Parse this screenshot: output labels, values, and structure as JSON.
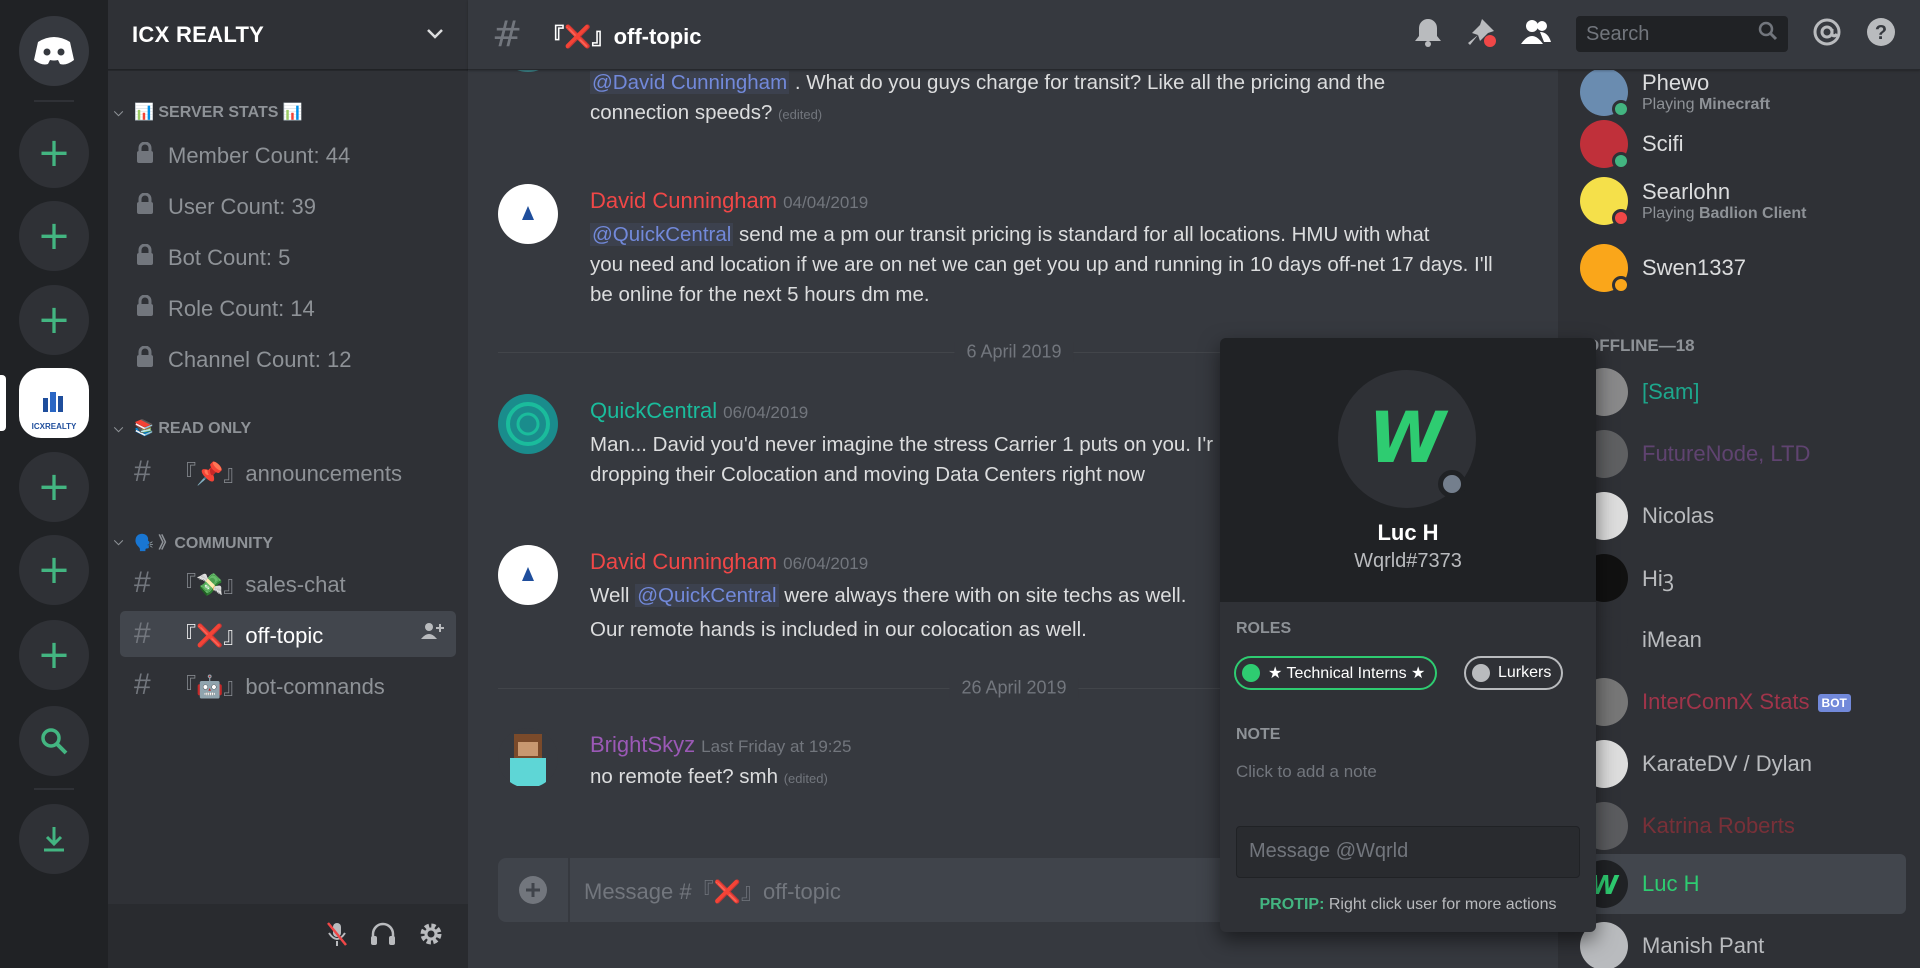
{
  "server": {
    "name": "ICX REALTY",
    "active_logo_text": "ICXREALTY"
  },
  "categories": {
    "stats": "📊 SERVER STATS 📊",
    "read_only": "📚 READ ONLY",
    "community": "🗣️ 》COMMUNITY"
  },
  "stats_channels": [
    "Member Count: 44",
    "User Count: 39",
    "Bot Count: 5",
    "Role Count: 14",
    "Channel Count: 12"
  ],
  "text_channels": {
    "announcements": "『📌』announcements",
    "sales_chat": "『💸』sales-chat",
    "off_topic": "『❌』off-topic",
    "bot_commands": "『🤖』bot-comnands"
  },
  "header": {
    "channel": "『❌』off-topic",
    "search_placeholder": "Search"
  },
  "messages": [
    {
      "mention": "@David Cunningham",
      "text": ". What do you guys charge for transit? Like all the pricing and the",
      "text2": "connection speeds?",
      "edited": "(edited)"
    },
    {
      "author": "David Cunningham",
      "time": "04/04/2019",
      "mention": "@QuickCentral",
      "text": "send me a pm our transit pricing is standard for all locations. HMU with what",
      "text2": "you need and location if we are on net we can get you up and running in 10 days off-net 17 days. I'll",
      "text3": "be online for the next 5 hours dm me."
    },
    {
      "author": "QuickCentral",
      "time": "06/04/2019",
      "text": "Man... David you'd never imagine the stress Carrier 1 puts on you. I'r",
      "text2": "dropping their Colocation and moving Data Centers right now"
    },
    {
      "author": "David Cunningham",
      "time": "06/04/2019",
      "pre": "Well",
      "mention": "@QuickCentral",
      "text": "were always there with on site techs as well.",
      "text2": "Our remote hands is included in our colocation as well."
    },
    {
      "author": "BrightSkyz",
      "time": "Last Friday at 19:25",
      "text": "no remote feet? smh",
      "edited": "(edited)"
    }
  ],
  "dividers": [
    "6 April 2019",
    "26 April 2019"
  ],
  "composer": {
    "placeholder": "Message #『❌』off-topic"
  },
  "members": {
    "online": [
      {
        "name": "Phewo",
        "activity_prefix": "Playing",
        "activity": "Minecraft"
      },
      {
        "name": "Scifi"
      },
      {
        "name": "Searlohn",
        "activity_prefix": "Playing",
        "activity": "Badlion Client"
      },
      {
        "name": "Swen1337"
      }
    ],
    "offline_header": "OFFLINE—18",
    "offline": [
      {
        "name": "[Sam]"
      },
      {
        "name": "FutureNode, LTD"
      },
      {
        "name": "Nicolas"
      },
      {
        "name": "Hiꝫ"
      },
      {
        "name": "iMean"
      },
      {
        "name": "InterConnX Stats",
        "badge": "BOT"
      },
      {
        "name": "KarateDV / Dylan"
      },
      {
        "name": "Katrina Roberts"
      },
      {
        "name": "Luc H"
      },
      {
        "name": "Manish Pant"
      }
    ]
  },
  "popout": {
    "name": "Luc H",
    "tag": "Wqrld#7373",
    "roles_label": "ROLES",
    "roles": [
      "★ Technical Interns ★",
      "Lurkers"
    ],
    "note_label": "NOTE",
    "note_placeholder": "Click to add a note",
    "message_placeholder": "Message @Wqrld",
    "protip_label": "PROTIP:",
    "protip_text": "Right click user for more actions"
  },
  "colors": {
    "accent_green": "#43b581",
    "mention_blue": "#7289da",
    "author_red": "#f04747",
    "author_teal": "#1abc9c",
    "author_purple": "#9b59b6",
    "luc_green": "#2ecc71"
  }
}
